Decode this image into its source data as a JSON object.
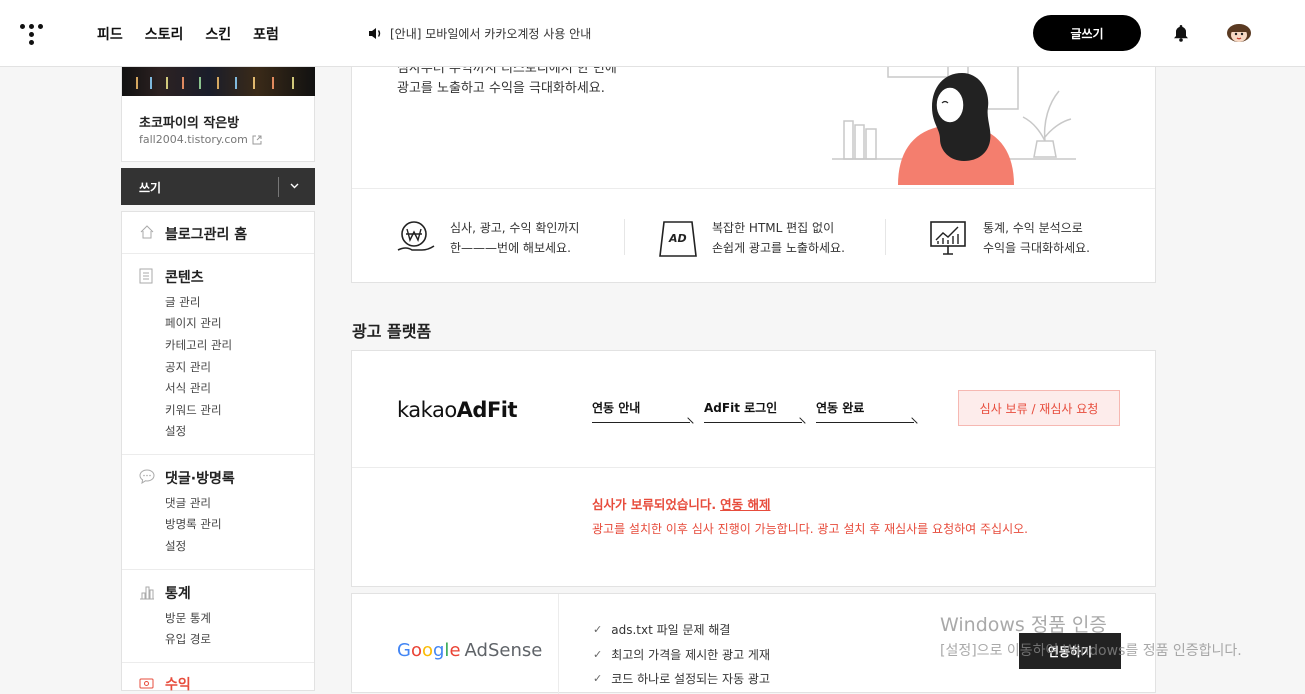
{
  "header": {
    "nav": [
      "피드",
      "스토리",
      "스킨",
      "포럼"
    ],
    "notice": "[안내] 모바일에서 카카오계정 사용 안내",
    "write_label": "글쓰기"
  },
  "blog": {
    "name": "초코파이의 작은방",
    "url": "fall2004.tistory.com"
  },
  "sidebar": {
    "write_label": "쓰기",
    "home": "블로그관리 홈",
    "sections": [
      {
        "title": "콘텐츠",
        "icon": "document-icon",
        "items": [
          "글 관리",
          "페이지 관리",
          "카테고리 관리",
          "공지 관리",
          "서식 관리",
          "키워드 관리",
          "설정"
        ]
      },
      {
        "title": "댓글·방명록",
        "icon": "speech-bubble-icon",
        "items": [
          "댓글 관리",
          "방명록 관리",
          "설정"
        ]
      },
      {
        "title": "통계",
        "icon": "bar-chart-icon",
        "items": [
          "방문 통계",
          "유입 경로"
        ]
      },
      {
        "title": "수익",
        "icon": "money-icon",
        "items": []
      }
    ]
  },
  "intro": {
    "partial_line": "심사부터 수익까지 티스토리에서 한 번에",
    "line": "광고를 노출하고 수익을 극대화하세요."
  },
  "features": [
    {
      "icon": "won-hand-icon",
      "line1": "심사, 광고, 수익 확인까지",
      "line2": "한———번에 해보세요."
    },
    {
      "icon": "ad-board-icon",
      "line1": "복잡한 HTML 편집 없이",
      "line2": "손쉽게 광고를 노출하세요."
    },
    {
      "icon": "analytics-monitor-icon",
      "line1": "통계, 수익 분석으로",
      "line2": "수익을 극대화하세요."
    }
  ],
  "platform_title": "광고 플랫폼",
  "adfit": {
    "logo_light": "kakao",
    "logo_bold": "AdFit",
    "steps": [
      "연동 안내",
      "AdFit 로그인",
      "연동 완료"
    ],
    "review_button": "심사 보류 / 재심사 요청",
    "hold_status": "심사가 보류되었습니다.",
    "unlink": "연동 해제",
    "hold_desc": "광고를 설치한 이후 심사 진행이 가능합니다. 광고 설치 후 재심사를 요청하여 주십시오."
  },
  "adsense": {
    "logo_google": [
      "G",
      "o",
      "o",
      "g",
      "l",
      "e"
    ],
    "logo_product": "AdSense",
    "checks": [
      "ads.txt 파일 문제 해결",
      "최고의 가격을 제시한 광고 게재",
      "코드 하나로 설정되는 자동 광고"
    ],
    "connect_button": "연동하기"
  },
  "watermark": {
    "line1": "Windows 정품 인증",
    "line2": "[설정]으로 이동하여 Windows를 정품 인증합니다."
  },
  "colors": {
    "accent_red": "#e74c3c",
    "dark": "#222222",
    "illustration_coral": "#f47e6e"
  }
}
